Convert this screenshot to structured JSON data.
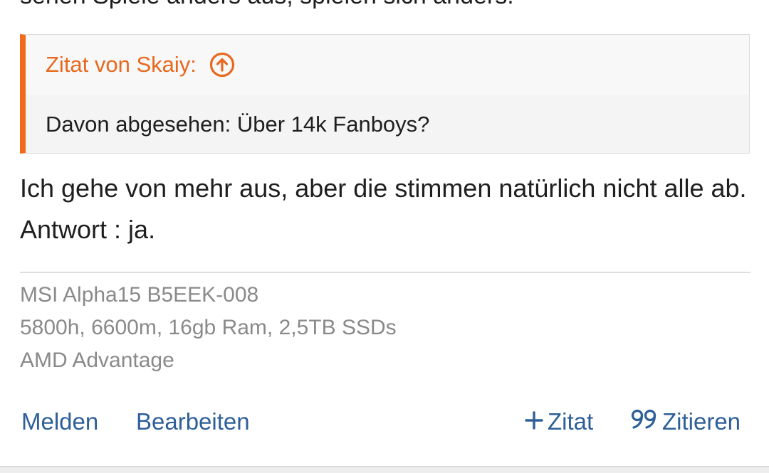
{
  "previous_post": {
    "cut_text": "sehen Spiele anders aus, spielen sich anders."
  },
  "quote": {
    "author_label": "Zitat von Skaiy:",
    "text": "Davon abgesehen: Über 14k Fanboys?",
    "accent_color": "#f26a1b",
    "jump_icon": "arrow-up-circle-icon"
  },
  "post": {
    "text": "Ich gehe von mehr aus, aber die stimmen natürlich nicht alle ab. Antwort : ja."
  },
  "signature": {
    "lines": [
      "MSI Alpha15 B5EEK-008",
      "5800h, 6600m, 16gb Ram, 2,5TB SSDs",
      "AMD Advantage"
    ]
  },
  "actions": {
    "report_label": "Melden",
    "edit_label": "Bearbeiten",
    "plus_quote_label": "Zitat",
    "quote_label": "Zitieren",
    "link_color": "#2e5f98"
  }
}
